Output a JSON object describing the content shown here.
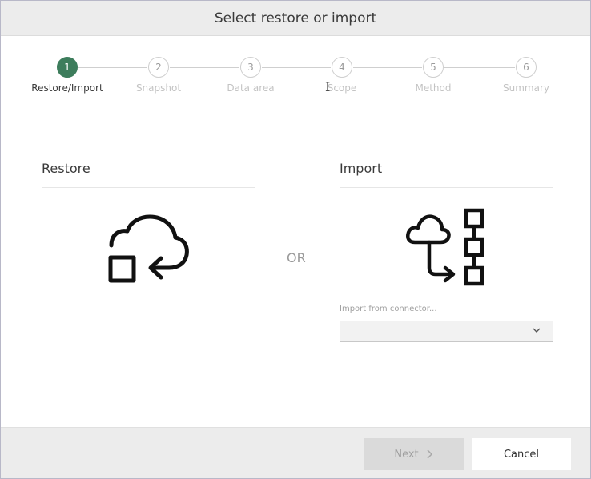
{
  "dialog": {
    "title": "Select restore or import"
  },
  "stepper": {
    "active_color": "#3d7d5c",
    "steps": [
      {
        "number": "1",
        "label": "Restore/Import",
        "active": true
      },
      {
        "number": "2",
        "label": "Snapshot",
        "active": false
      },
      {
        "number": "3",
        "label": "Data area",
        "active": false
      },
      {
        "number": "4",
        "label": "Scope",
        "active": false
      },
      {
        "number": "5",
        "label": "Method",
        "active": false
      },
      {
        "number": "6",
        "label": "Summary",
        "active": false
      }
    ]
  },
  "restore": {
    "title": "Restore",
    "icon": "cloud-restore-icon"
  },
  "separator": {
    "label": "OR"
  },
  "import": {
    "title": "Import",
    "icon": "cloud-import-icon",
    "connector_label": "Import from connector...",
    "connector_value": ""
  },
  "footer": {
    "next_label": "Next",
    "cancel_label": "Cancel"
  }
}
